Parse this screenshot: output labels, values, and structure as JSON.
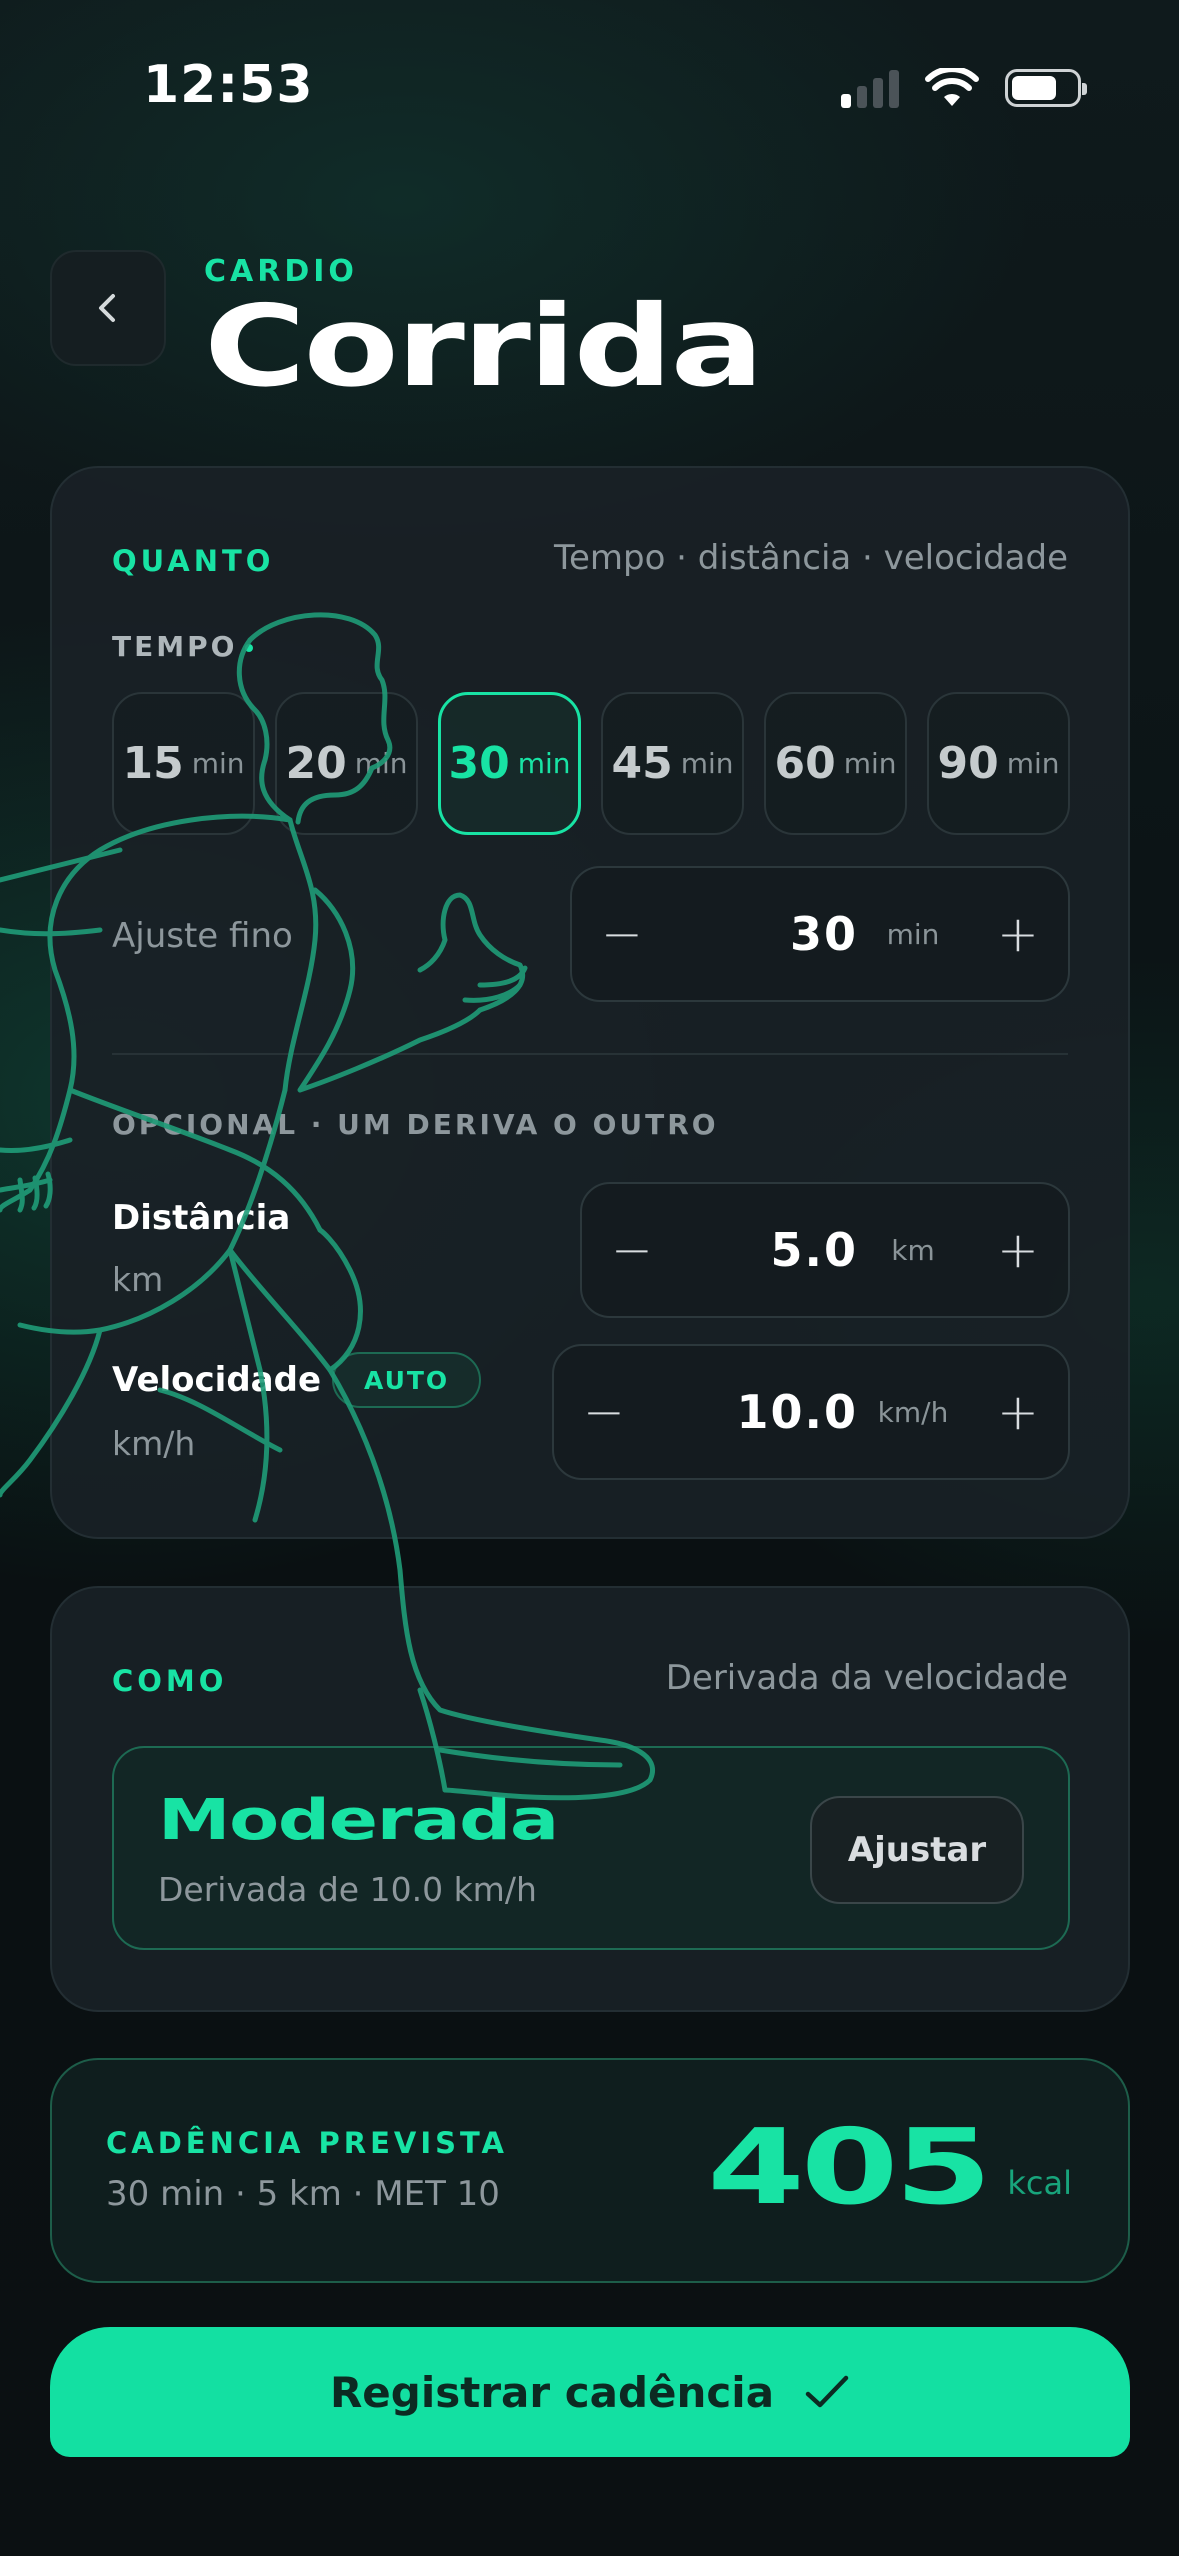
{
  "status_bar": {
    "time": "12:53"
  },
  "header": {
    "eyebrow": "CARDIO",
    "title": "Corrida"
  },
  "quanto": {
    "label": "QUANTO",
    "hint": "Tempo · distância · velocidade",
    "tempo_label": "TEMPO",
    "chips": [
      {
        "value": "15",
        "unit": "min",
        "selected": false
      },
      {
        "value": "20",
        "unit": "min",
        "selected": false
      },
      {
        "value": "30",
        "unit": "min",
        "selected": true
      },
      {
        "value": "45",
        "unit": "min",
        "selected": false
      },
      {
        "value": "60",
        "unit": "min",
        "selected": false
      },
      {
        "value": "90",
        "unit": "min",
        "selected": false
      }
    ],
    "ajuste": {
      "label": "Ajuste fino",
      "value": "30",
      "unit": "min"
    },
    "optional_label": "OPCIONAL · UM DERIVA O OUTRO",
    "distancia": {
      "label": "Distância",
      "sub": "km",
      "value": "5.0",
      "unit": "km"
    },
    "velocidade": {
      "label": "Velocidade",
      "badge": "AUTO",
      "sub": "km/h",
      "value": "10.0",
      "unit": "km/h"
    }
  },
  "como": {
    "label": "COMO",
    "hint": "Derivada da velocidade",
    "intensity": "Moderada",
    "intensity_sub": "Derivada de 10.0 km/h",
    "adjust": "Ajustar"
  },
  "cadencia": {
    "label": "CADÊNCIA PREVISTA",
    "sub": "30 min · 5 km · MET 10",
    "value": "405",
    "unit": "kcal"
  },
  "cta": {
    "label": "Registrar cadência"
  },
  "colors": {
    "accent": "#18e3a4",
    "background": "#0b1114",
    "card": "#192126"
  }
}
